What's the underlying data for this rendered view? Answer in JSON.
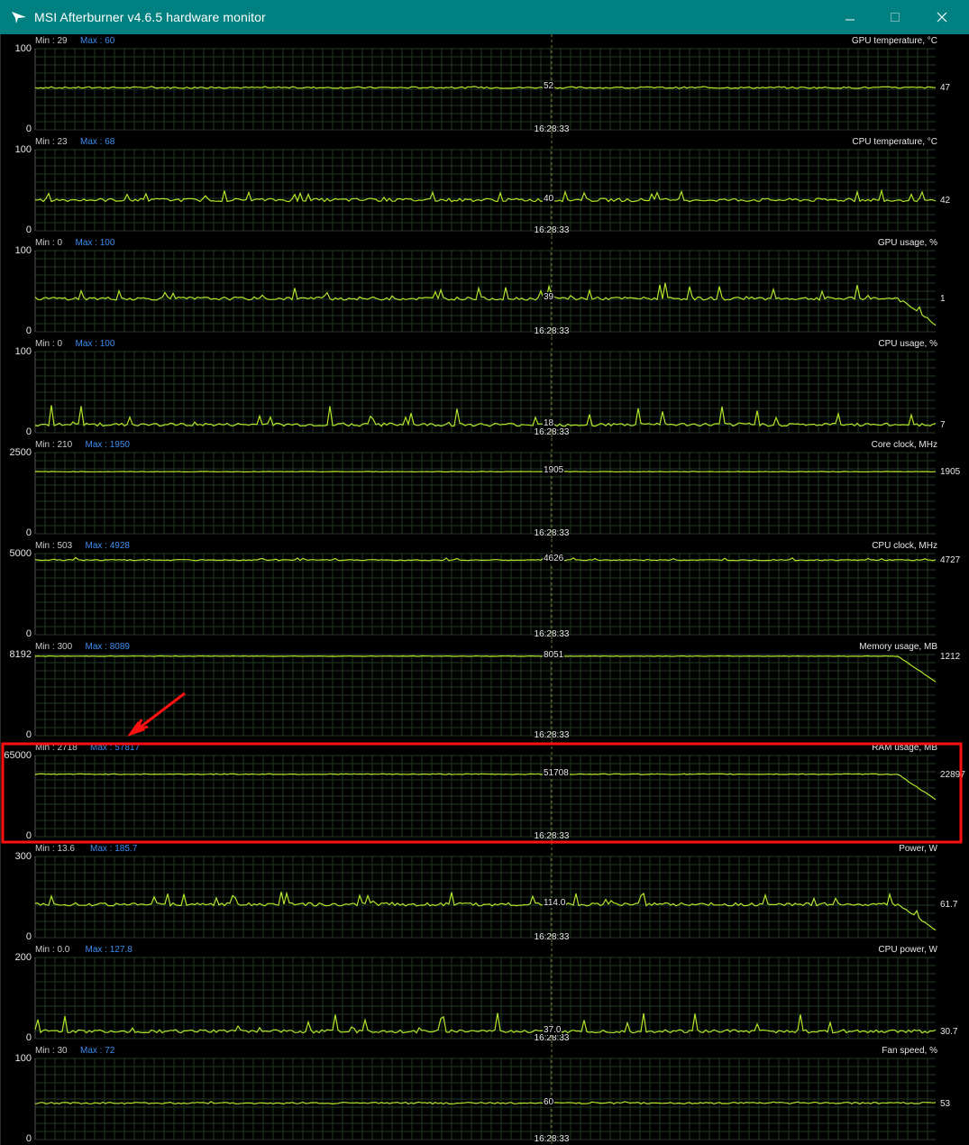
{
  "window": {
    "title": "MSI Afterburner v4.6.5 hardware monitor",
    "app_icon": "afterburner-plane-icon",
    "buttons": [
      "minimize-icon",
      "maximize-icon",
      "close-icon"
    ]
  },
  "colors": {
    "titlebar": "#008080",
    "line": "#b4e62a",
    "grid": "#1f3a1f",
    "min_text": "#c9c9c9",
    "max_text": "#3a8df0",
    "highlight": "#ff1010"
  },
  "graphs": [
    {
      "name": "GPU temperature, °C",
      "min": "Min : 29",
      "max": "Max : 60",
      "ytop": "100",
      "ybottom": "0",
      "time": "16:28:33",
      "cursor_value": "52",
      "current_value": "47"
    },
    {
      "name": "CPU temperature, °C",
      "min": "Min : 23",
      "max": "Max : 68",
      "ytop": "100",
      "ybottom": "0",
      "time": "16:28:33",
      "cursor_value": "40",
      "current_value": "42"
    },
    {
      "name": "GPU usage, %",
      "min": "Min : 0",
      "max": "Max : 100",
      "ytop": "100",
      "ybottom": "0",
      "time": "16:28:33",
      "cursor_value": "39",
      "current_value": "1"
    },
    {
      "name": "CPU usage, %",
      "min": "Min : 0",
      "max": "Max : 100",
      "ytop": "100",
      "ybottom": "0",
      "time": "16:28:33",
      "cursor_value": "18",
      "current_value": "7"
    },
    {
      "name": "Core clock, MHz",
      "min": "Min : 210",
      "max": "Max : 1950",
      "ytop": "2500",
      "ybottom": "0",
      "time": "16:28:33",
      "cursor_value": "1905",
      "current_value": "1905"
    },
    {
      "name": "CPU clock, MHz",
      "min": "Min : 503",
      "max": "Max : 4928",
      "ytop": "5000",
      "ybottom": "0",
      "time": "16:28:33",
      "cursor_value": "4626",
      "current_value": "4727"
    },
    {
      "name": "Memory usage, MB",
      "min": "Min : 300",
      "max": "Max : 8089",
      "ytop": "8192",
      "ybottom": "0",
      "time": "16:28:33",
      "cursor_value": "8051",
      "current_value": "1212"
    },
    {
      "name": "RAM usage, MB",
      "min": "Min : 2718",
      "max": "Max : 57817",
      "ytop": "65000",
      "ybottom": "0",
      "time": "16:28:33",
      "cursor_value": "51708",
      "current_value": "22897",
      "highlighted": true
    },
    {
      "name": "Power, W",
      "min": "Min : 13.6",
      "max": "Max : 185.7",
      "ytop": "300",
      "ybottom": "0",
      "time": "16:28:33",
      "cursor_value": "114.0",
      "current_value": "61.7"
    },
    {
      "name": "CPU power, W",
      "min": "Min : 0.0",
      "max": "Max : 127.8",
      "ytop": "200",
      "ybottom": "0",
      "time": "16:28:33",
      "cursor_value": "37.0",
      "current_value": "30.7"
    },
    {
      "name": "Fan speed, %",
      "min": "Min : 30",
      "max": "Max : 72",
      "ytop": "100",
      "ybottom": "0",
      "time": "16:28:33",
      "cursor_value": "60",
      "current_value": "53"
    }
  ]
}
